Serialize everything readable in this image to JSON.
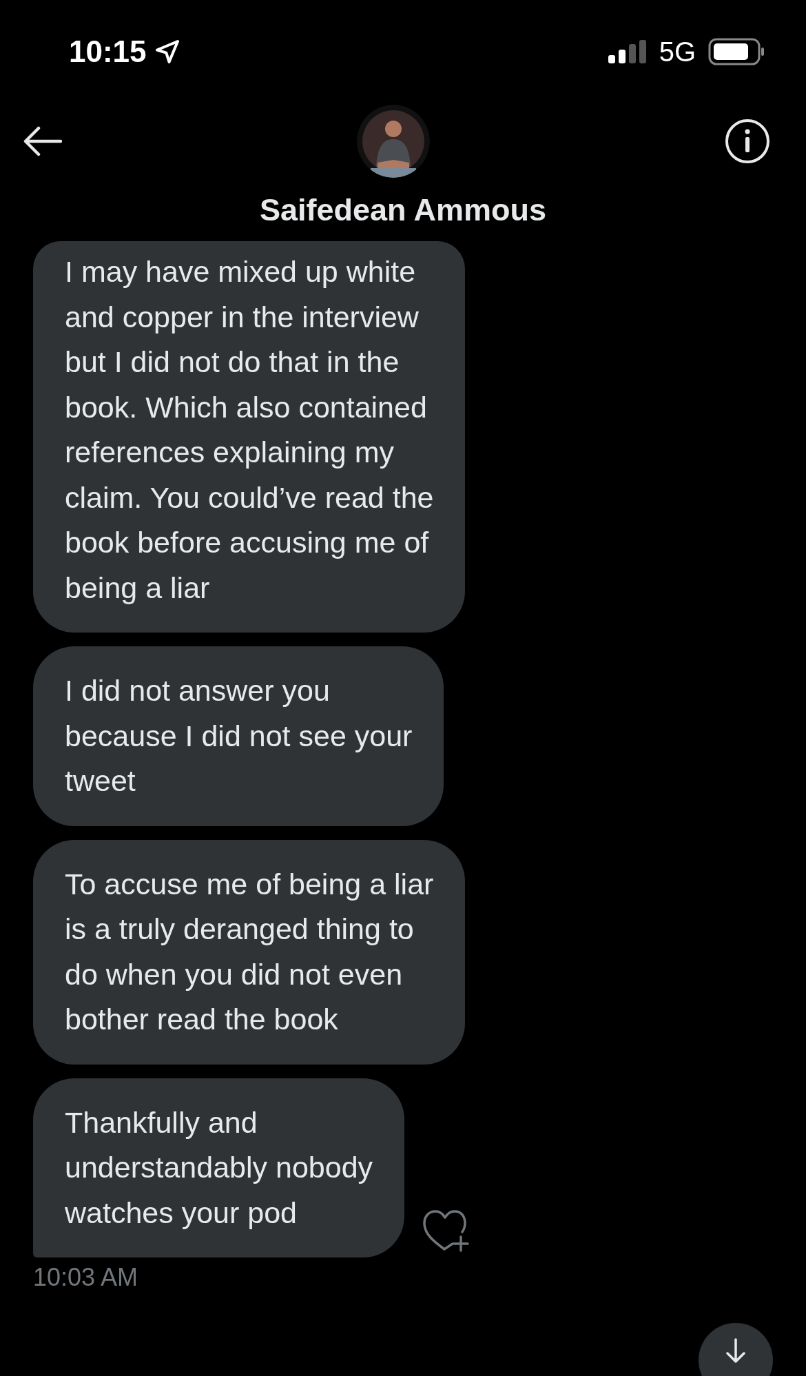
{
  "status_bar": {
    "time": "10:15",
    "network": "5G"
  },
  "header": {
    "name": "Saifedean Ammous"
  },
  "messages": [
    {
      "text": "I may have mixed up white\nand copper in the interview\nbut I did not do that in the\nbook. Which also contained\nreferences explaining my\nclaim. You could’ve read the\nbook before accusing me of\nbeing a liar"
    },
    {
      "text": "I did not answer you\nbecause I did not see your\ntweet"
    },
    {
      "text": "To accuse me of being a liar\nis a truly deranged thing to\ndo when you did not even\nbother read the book"
    },
    {
      "text": "Thankfully and\nunderstandably nobody\nwatches your pod"
    }
  ],
  "timestamp": "10:03 AM"
}
